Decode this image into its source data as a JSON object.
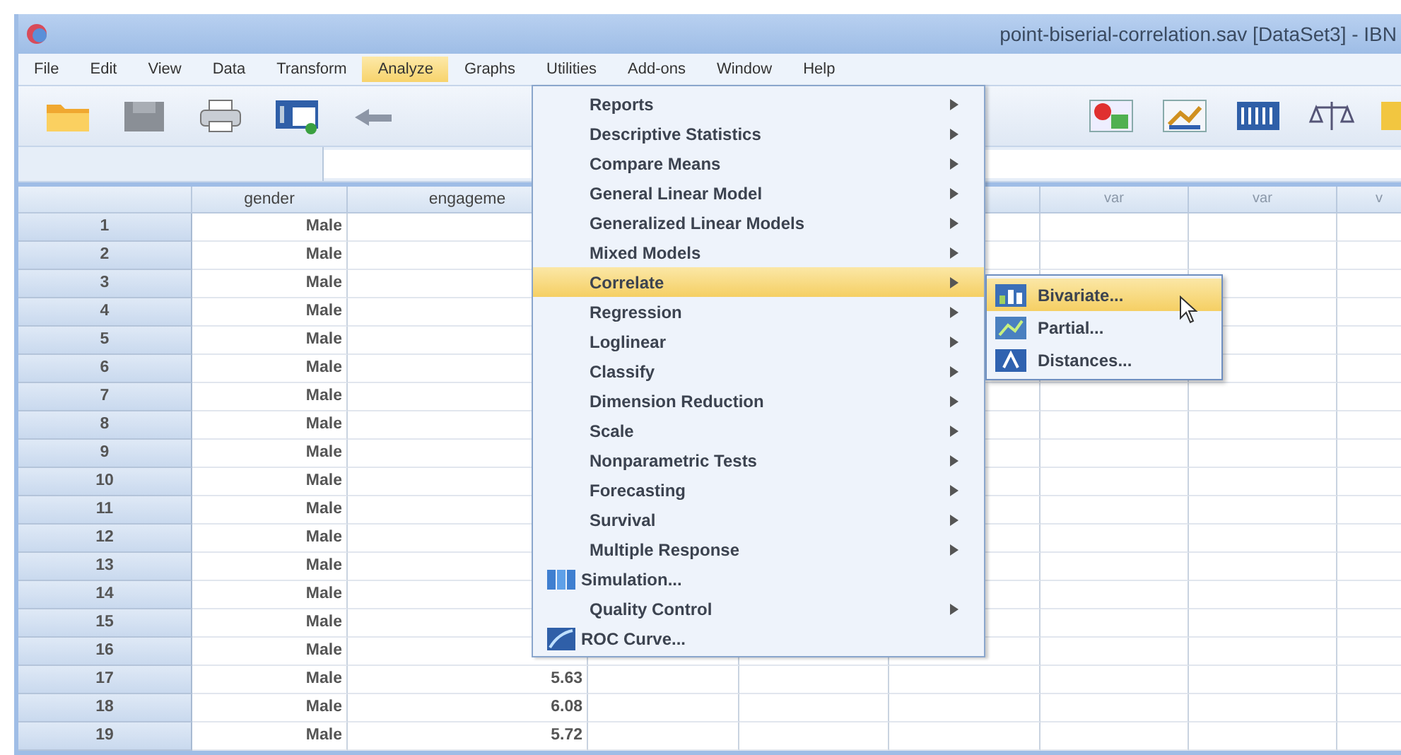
{
  "window": {
    "title": "point-biserial-correlation.sav [DataSet3] - IBN"
  },
  "menu_bar": [
    {
      "label": "File",
      "selected": false
    },
    {
      "label": "Edit",
      "selected": false
    },
    {
      "label": "View",
      "selected": false
    },
    {
      "label": "Data",
      "selected": false
    },
    {
      "label": "Transform",
      "selected": false
    },
    {
      "label": "Analyze",
      "selected": true
    },
    {
      "label": "Graphs",
      "selected": false
    },
    {
      "label": "Utilities",
      "selected": false
    },
    {
      "label": "Add-ons",
      "selected": false
    },
    {
      "label": "Window",
      "selected": false
    },
    {
      "label": "Help",
      "selected": false
    }
  ],
  "grid": {
    "columns": [
      {
        "label": "gender"
      },
      {
        "label": "engageme"
      },
      {},
      {},
      {},
      {
        "label": "var"
      },
      {
        "label": "var"
      },
      {
        "label": "v"
      }
    ],
    "rows": [
      {
        "number": "1",
        "cells": [
          "Male"
        ]
      },
      {
        "number": "2",
        "cells": [
          "Male"
        ]
      },
      {
        "number": "3",
        "cells": [
          "Male"
        ]
      },
      {
        "number": "4",
        "cells": [
          "Male"
        ]
      },
      {
        "number": "5",
        "cells": [
          "Male"
        ]
      },
      {
        "number": "6",
        "cells": [
          "Male"
        ]
      },
      {
        "number": "7",
        "cells": [
          "Male"
        ]
      },
      {
        "number": "8",
        "cells": [
          "Male"
        ]
      },
      {
        "number": "9",
        "cells": [
          "Male"
        ]
      },
      {
        "number": "10",
        "cells": [
          "Male"
        ]
      },
      {
        "number": "11",
        "cells": [
          "Male"
        ]
      },
      {
        "number": "12",
        "cells": [
          "Male"
        ]
      },
      {
        "number": "13",
        "cells": [
          "Male"
        ]
      },
      {
        "number": "14",
        "cells": [
          "Male"
        ]
      },
      {
        "number": "15",
        "cells": [
          "Male"
        ]
      },
      {
        "number": "16",
        "cells": [
          "Male"
        ]
      },
      {
        "number": "17",
        "cells": [
          "Male",
          "5.63"
        ]
      },
      {
        "number": "18",
        "cells": [
          "Male",
          "6.08"
        ]
      },
      {
        "number": "19",
        "cells": [
          "Male",
          "5.72"
        ]
      }
    ]
  },
  "analyze_menu": [
    {
      "label": "Reports",
      "kind": "submenu",
      "selected": false
    },
    {
      "label": "Descriptive Statistics",
      "kind": "submenu",
      "selected": false
    },
    {
      "label": "Compare Means",
      "kind": "submenu",
      "selected": false
    },
    {
      "label": "General Linear Model",
      "kind": "submenu",
      "selected": false
    },
    {
      "label": "Generalized Linear Models",
      "kind": "submenu",
      "selected": false
    },
    {
      "label": "Mixed Models",
      "kind": "submenu",
      "selected": false
    },
    {
      "label": "Correlate",
      "kind": "submenu",
      "selected": true
    },
    {
      "label": "Regression",
      "kind": "submenu",
      "selected": false
    },
    {
      "label": "Loglinear",
      "kind": "submenu",
      "selected": false
    },
    {
      "label": "Classify",
      "kind": "submenu",
      "selected": false
    },
    {
      "label": "Dimension Reduction",
      "kind": "submenu",
      "selected": false
    },
    {
      "label": "Scale",
      "kind": "submenu",
      "selected": false
    },
    {
      "label": "Nonparametric Tests",
      "kind": "submenu",
      "selected": false
    },
    {
      "label": "Forecasting",
      "kind": "submenu",
      "selected": false
    },
    {
      "label": "Survival",
      "kind": "submenu",
      "selected": false
    },
    {
      "label": "Multiple Response",
      "kind": "submenu",
      "selected": false
    },
    {
      "label": "Simulation...",
      "kind": "command",
      "selected": false
    },
    {
      "label": "Quality Control",
      "kind": "submenu",
      "selected": false
    },
    {
      "label": "ROC Curve...",
      "kind": "command",
      "selected": false
    }
  ],
  "correlate_submenu": [
    {
      "label": "Bivariate...",
      "selected": true
    },
    {
      "label": "Partial...",
      "selected": false
    },
    {
      "label": "Distances...",
      "selected": false
    }
  ]
}
